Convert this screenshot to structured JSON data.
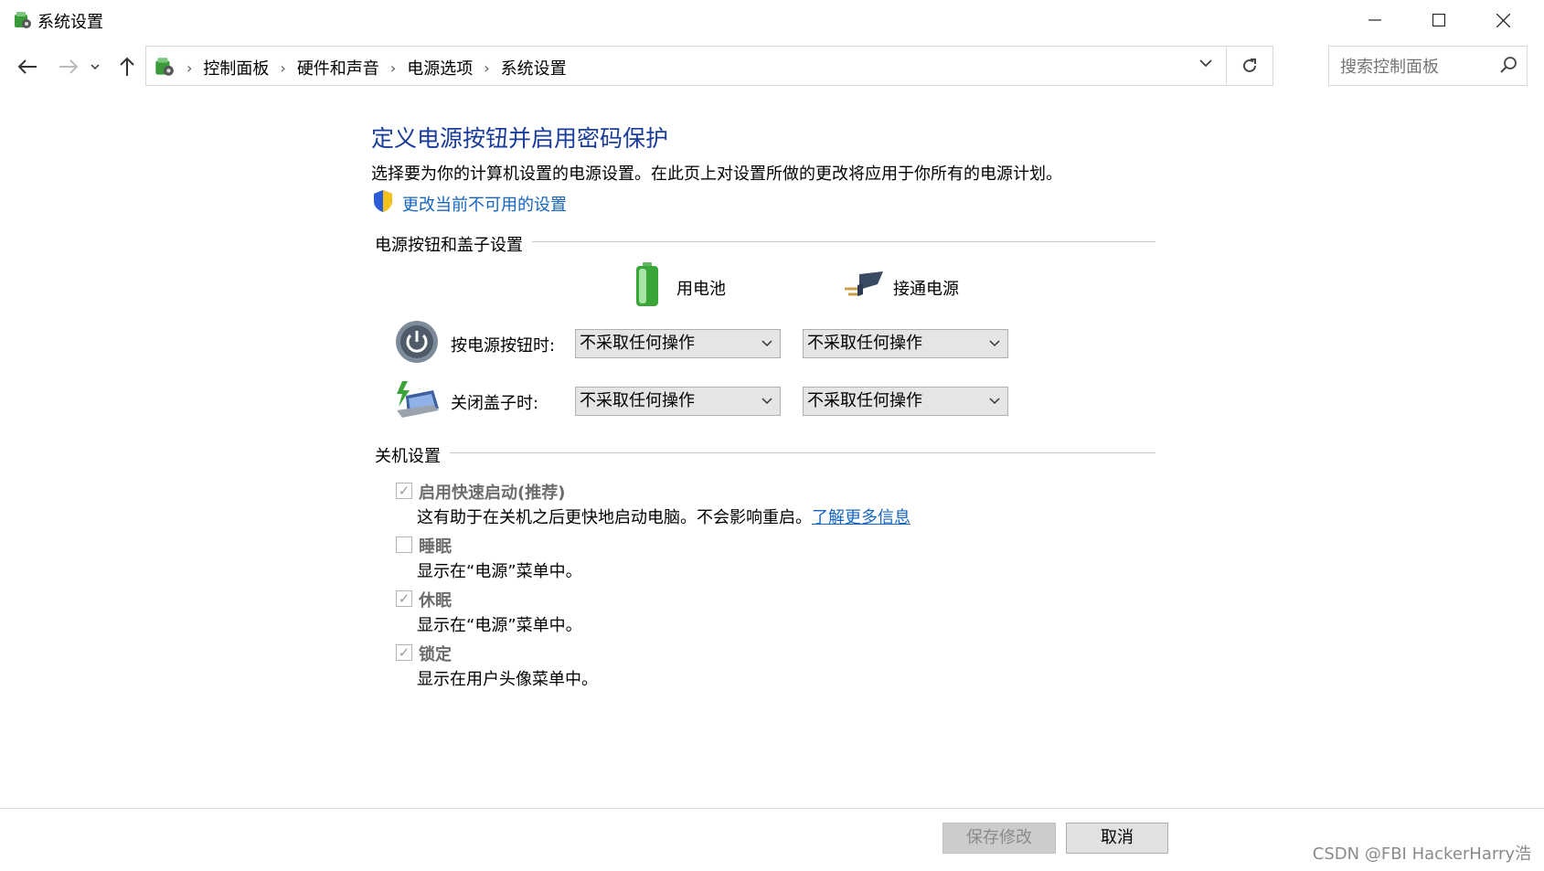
{
  "window": {
    "title": "系统设置",
    "minimize_icon": "minimize-icon",
    "maximize_icon": "maximize-icon",
    "close_icon": "close-icon"
  },
  "address": {
    "breadcrumbs": [
      "控制面板",
      "硬件和声音",
      "电源选项",
      "系统设置"
    ]
  },
  "search": {
    "placeholder": "搜索控制面板"
  },
  "page": {
    "heading": "定义电源按钮并启用密码保护",
    "subtitle": "选择要为你的计算机设置的电源设置。在此页上对设置所做的更改将应用于你所有的电源计划。",
    "change_link": "更改当前不可用的设置"
  },
  "power_group": {
    "title": "电源按钮和盖子设置",
    "col_battery": "用电池",
    "col_plugged": "接通电源",
    "rows": [
      {
        "label": "按电源按钮时:",
        "battery": "不采取任何操作",
        "plugged": "不采取任何操作"
      },
      {
        "label": "关闭盖子时:",
        "battery": "不采取任何操作",
        "plugged": "不采取任何操作"
      }
    ]
  },
  "shutdown_group": {
    "title": "关机设置",
    "options": [
      {
        "label": "启用快速启动(推荐)",
        "checked": true,
        "desc": "这有助于在关机之后更快地启动电脑。不会影响重启。",
        "link": "了解更多信息"
      },
      {
        "label": "睡眠",
        "checked": false,
        "desc": "显示在“电源”菜单中。"
      },
      {
        "label": "休眠",
        "checked": true,
        "desc": "显示在“电源”菜单中。"
      },
      {
        "label": "锁定",
        "checked": true,
        "desc": "显示在用户头像菜单中。"
      }
    ]
  },
  "footer": {
    "save_label": "保存修改",
    "cancel_label": "取消"
  },
  "watermark": "CSDN @FBI HackerHarry浩",
  "colors": {
    "heading": "#1a3c9a",
    "link": "#1565c0"
  }
}
